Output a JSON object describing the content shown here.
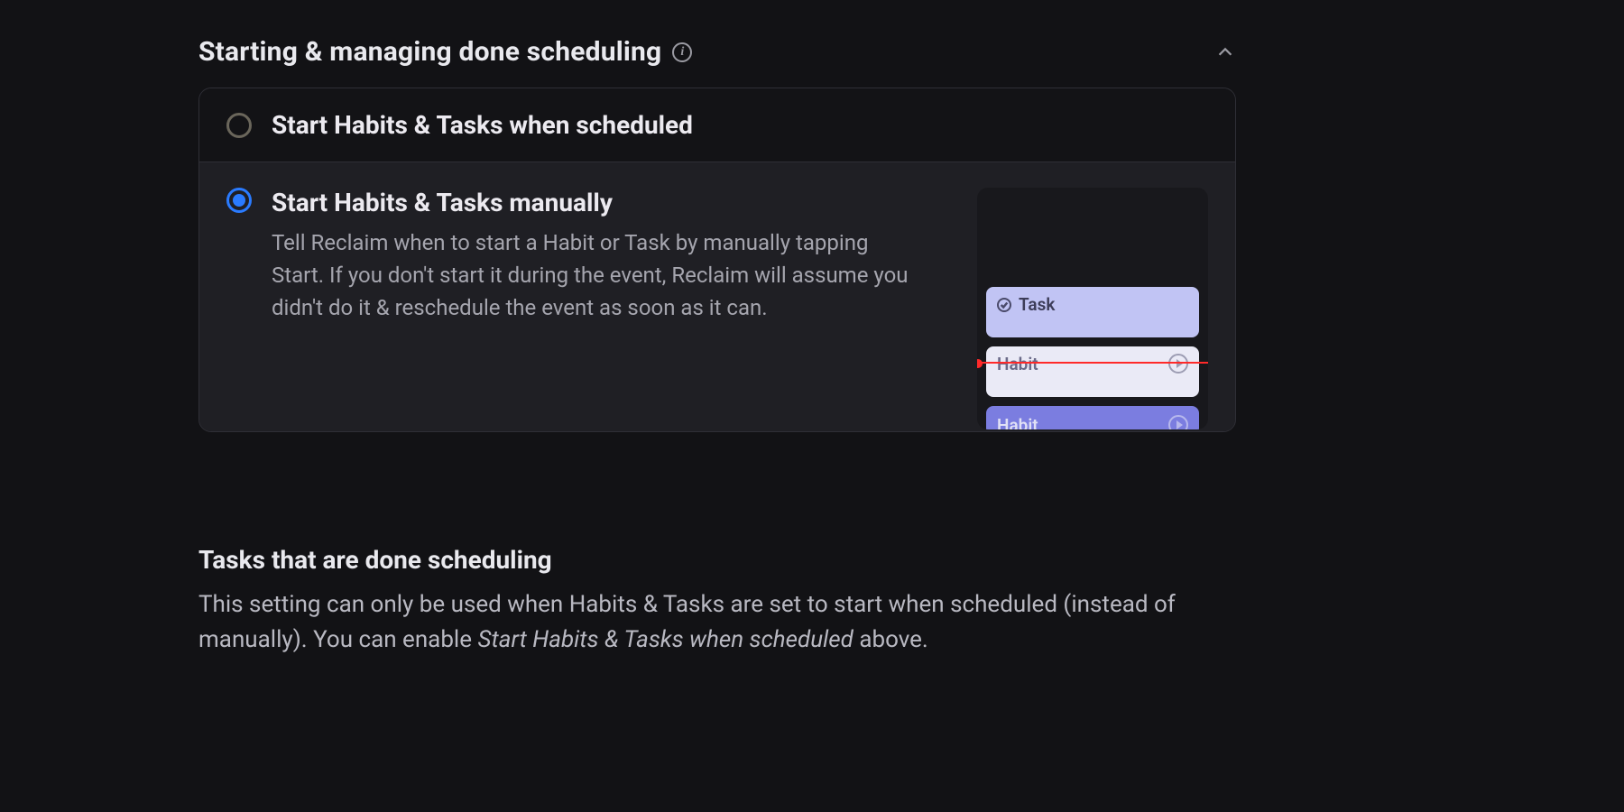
{
  "section": {
    "title": "Starting & managing done scheduling",
    "info_tooltip": "i"
  },
  "options": {
    "scheduled": {
      "title": "Start Habits & Tasks when scheduled",
      "selected": false
    },
    "manual": {
      "title": "Start Habits & Tasks manually",
      "description": "Tell Reclaim when to start a Habit or Task by manually tapping Start. If you don't start it during the event, Reclaim will assume you didn't do it & reschedule the event as soon as it can.",
      "selected": true
    }
  },
  "preview": {
    "items": [
      {
        "label": "Task",
        "kind": "task",
        "done": true
      },
      {
        "label": "Habit",
        "kind": "habit-light",
        "play": true
      },
      {
        "label": "Habit",
        "kind": "habit-dark",
        "play": true
      }
    ]
  },
  "lower": {
    "title": "Tasks that are done scheduling",
    "body_pre": "This setting can only be used when Habits & Tasks are set to start when scheduled (instead of manually). You can enable ",
    "body_ital": "Start Habits & Tasks when scheduled",
    "body_post": " above."
  },
  "colors": {
    "accent": "#2a7bff",
    "timeline": "#ff2a2a",
    "bg": "#121215"
  }
}
